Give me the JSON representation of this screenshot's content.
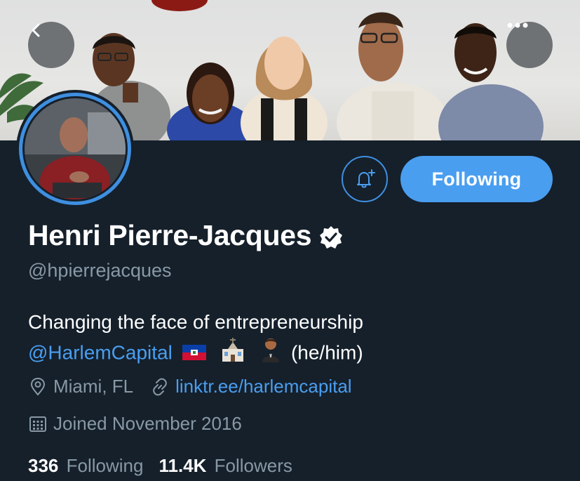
{
  "header": {
    "back_icon": "chevron-left-icon",
    "more_icon": "more-horizontal-icon"
  },
  "profile": {
    "name": "Henri Pierre-Jacques",
    "handle": "@hpierrejacques",
    "verified": true,
    "bio_line1": "Changing the face of entrepreneurship",
    "bio_mention": "@HarlemCapital",
    "bio_emojis": [
      "haiti-flag",
      "church",
      "man-in-tuxedo"
    ],
    "bio_pronouns": "(he/him)",
    "location": "Miami, FL",
    "website": "linktr.ee/harlemcapital",
    "joined": "Joined November 2016"
  },
  "actions": {
    "notify_icon": "bell-plus-icon",
    "follow_label": "Following"
  },
  "stats": {
    "following_count": "336",
    "following_label": "Following",
    "followers_count": "11.4K",
    "followers_label": "Followers"
  },
  "colors": {
    "background": "#15202b",
    "accent": "#4a9ef0",
    "secondary_text": "#8899a6"
  }
}
